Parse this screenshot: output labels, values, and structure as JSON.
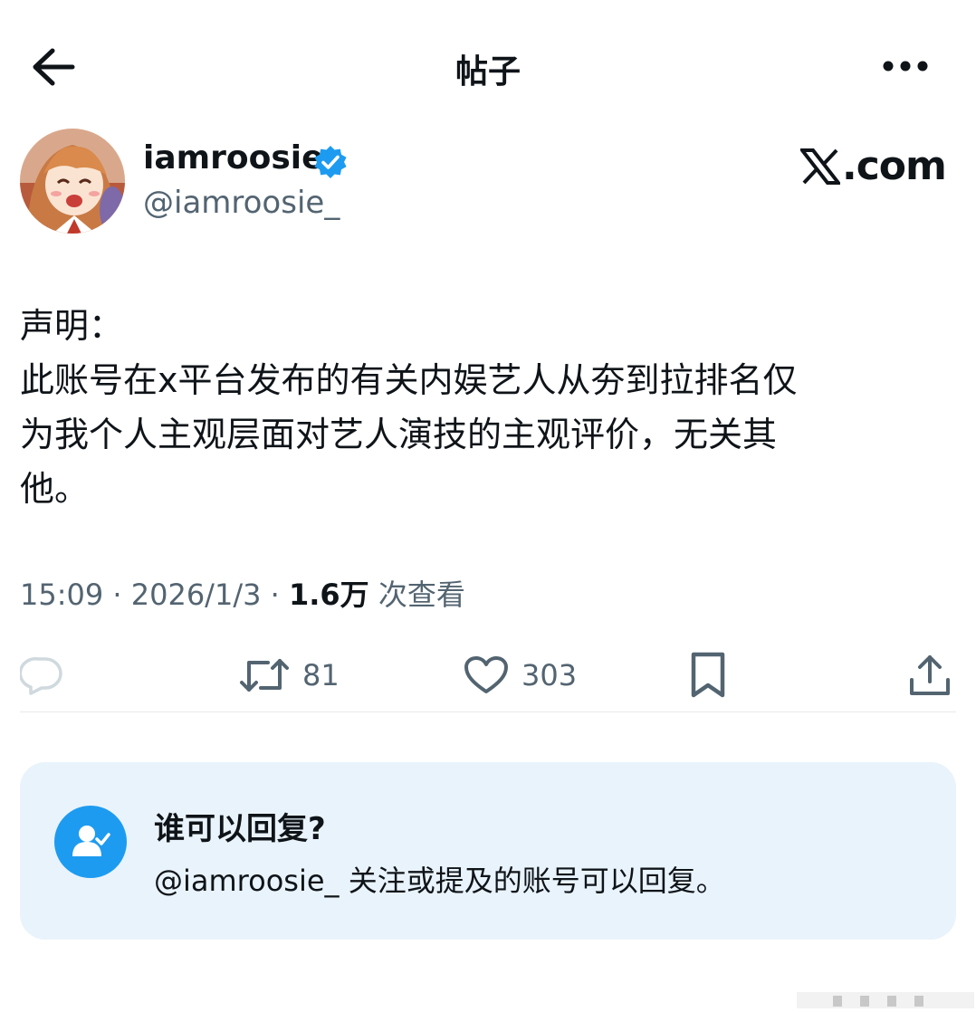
{
  "header": {
    "title": "帖子",
    "back_icon": "arrow-left-icon",
    "more_icon": "more-horizontal-icon"
  },
  "author": {
    "name": "iamroosie",
    "handle": "@iamroosie_",
    "verified": true
  },
  "watermark": {
    "text": "𝕏.com"
  },
  "post": {
    "lines": [
      "声明：",
      "此账号在x平台发布的有关内娱艺人从夯到拉排名仅",
      "为我个人主观层面对艺人演技的主观评价，无关其",
      "他。"
    ],
    "time": "15:09",
    "date": "2026/1/3",
    "views_count": "1.6万",
    "views_label": "次查看"
  },
  "actions": {
    "reply_icon": "reply-icon",
    "repost_icon": "repost-icon",
    "repost_count": "81",
    "like_icon": "heart-icon",
    "like_count": "303",
    "bookmark_icon": "bookmark-icon",
    "share_icon": "share-icon"
  },
  "reply_settings": {
    "title": "谁可以回复?",
    "description": "@iamroosie_ 关注或提及的账号可以回复。"
  },
  "colors": {
    "accent": "#1d9bf0",
    "text": "#0f1419",
    "secondary": "#536471",
    "card_bg": "#e9f3fb"
  }
}
